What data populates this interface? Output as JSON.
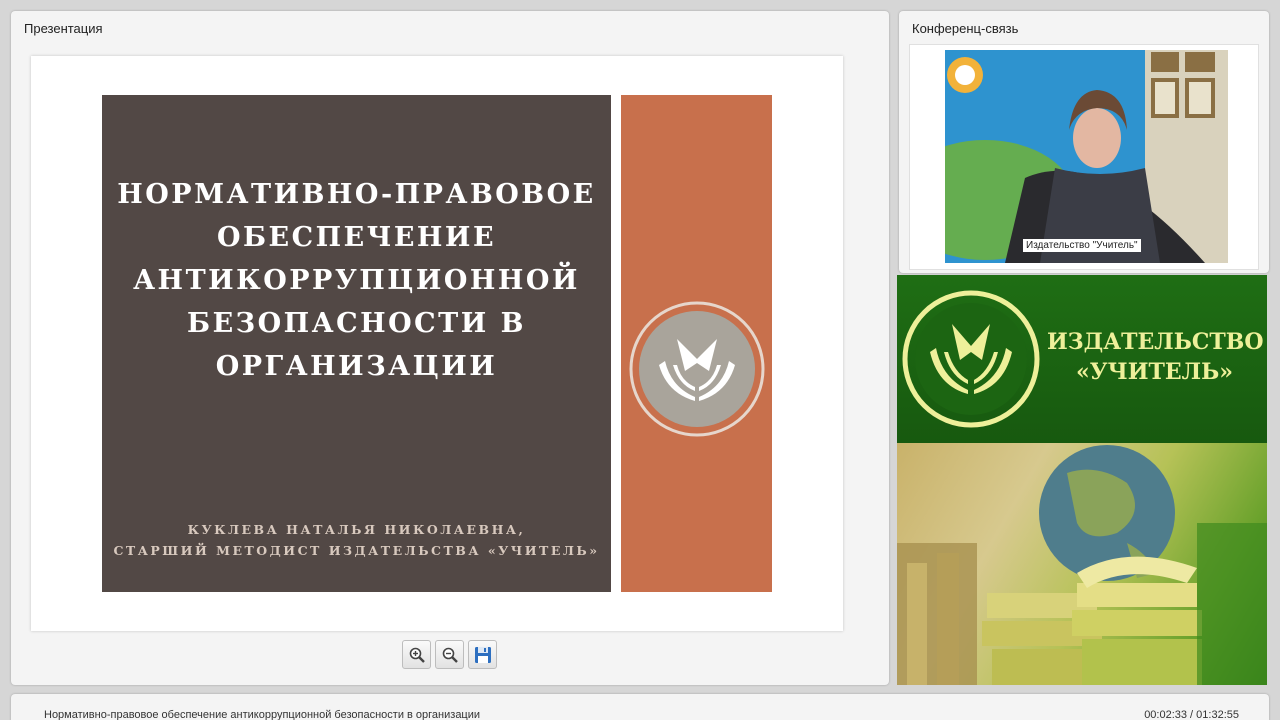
{
  "presentation": {
    "title": "Презентация",
    "slide": {
      "title_lines": [
        "НОРМАТИВНО-ПРАВОВОЕ",
        "ОБЕСПЕЧЕНИЕ",
        "АНТИКОРРУПЦИОННОЙ",
        "БЕЗОПАСНОСТИ В",
        "ОРГАНИЗАЦИИ"
      ],
      "author_lines": [
        "КУКЛЕВА НАТАЛЬЯ НИКОЛАЕВНА,",
        "СТАРШИЙ МЕТОДИСТ ИЗДАТЕЛЬСТВА «УЧИТЕЛЬ»"
      ],
      "colors": {
        "dark": "#524845",
        "accent": "#c8704c"
      }
    },
    "toolbar": {
      "buttons": [
        {
          "name": "zoom-in",
          "icon": "zoom-in-icon"
        },
        {
          "name": "zoom-out",
          "icon": "zoom-out-icon"
        },
        {
          "name": "save",
          "icon": "floppy-disk-icon"
        }
      ]
    }
  },
  "conference": {
    "title": "Конференц-связь",
    "participant_name": "Издательство \"Учитель\"",
    "backdrop_text": "Учитель"
  },
  "banner": {
    "line1": "ИЗДАТЕЛЬСТВО",
    "line2": "«УЧИТЕЛЬ»",
    "colors": {
      "green": "#1f6e14",
      "text": "#eef09a"
    }
  },
  "footer": {
    "title": "Нормативно-правовое обеспечение антикоррупционной безопасности в организации",
    "time": "00:02:33 / 01:32:55"
  }
}
